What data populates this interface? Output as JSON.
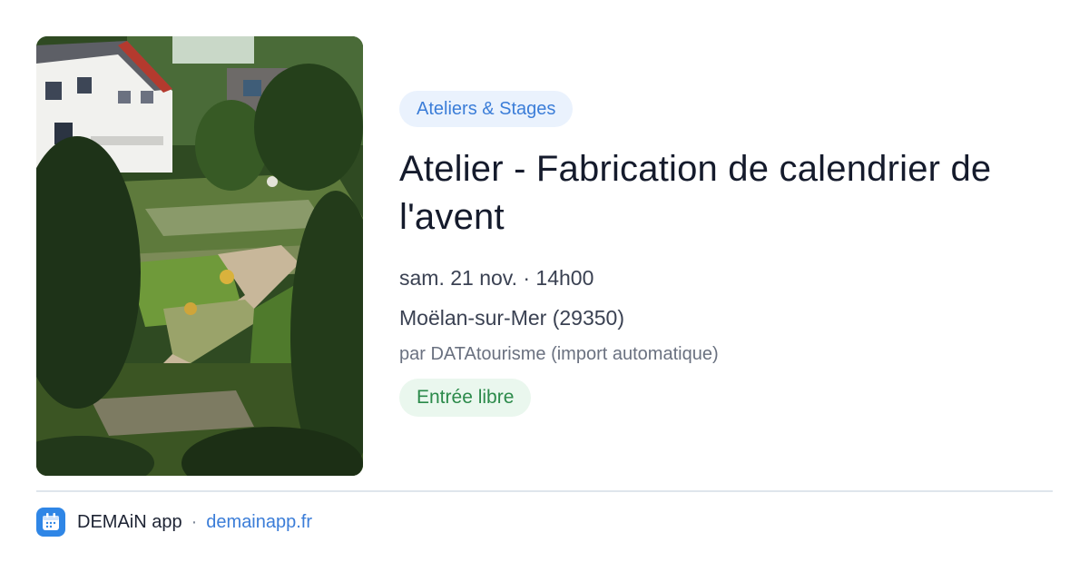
{
  "event": {
    "category": "Ateliers & Stages",
    "title": "Atelier - Fabrication de calendrier de l'avent",
    "datetime": "sam. 21 nov. · 14h00",
    "location": "Moëlan-sur-Mer (29350)",
    "organizer": "par DATAtourisme (import automatique)",
    "price": "Entrée libre"
  },
  "footer": {
    "app_name": "DEMAiN app",
    "separator": "·",
    "site": "demainapp.fr"
  },
  "colors": {
    "category_bg": "#eaf2fd",
    "category_text": "#3b7dd8",
    "price_bg": "#eaf7ee",
    "price_text": "#2b8a4a",
    "link": "#3b7dd8",
    "app_logo": "#2f86e6"
  },
  "image": {
    "icon": "garden-photo"
  }
}
